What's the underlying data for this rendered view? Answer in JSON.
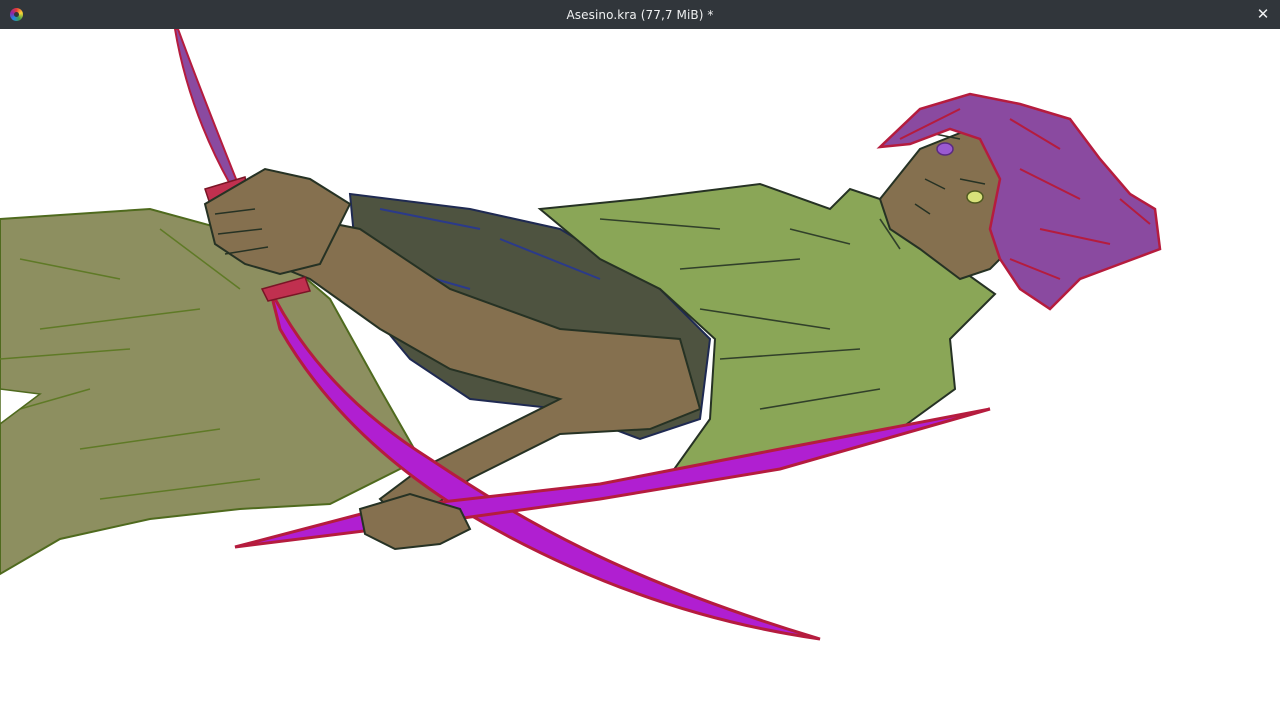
{
  "window": {
    "title": "Asesino.kra (77,7 MiB) *",
    "app_icon": "krita-icon",
    "close_glyph": "✕",
    "close_icon": "close-icon"
  },
  "canvas": {
    "background": "#ffffff"
  },
  "colors": {
    "titlebar": "#31363b",
    "title_text": "#eff0f1",
    "skin": "#85704f",
    "shirt": "#8aa657",
    "undershirt": "#4e5340",
    "pants": "#8d8f60",
    "hair": "#8a4aa0",
    "blade": "#b01fd1",
    "blade_edge": "#b51c3e"
  }
}
